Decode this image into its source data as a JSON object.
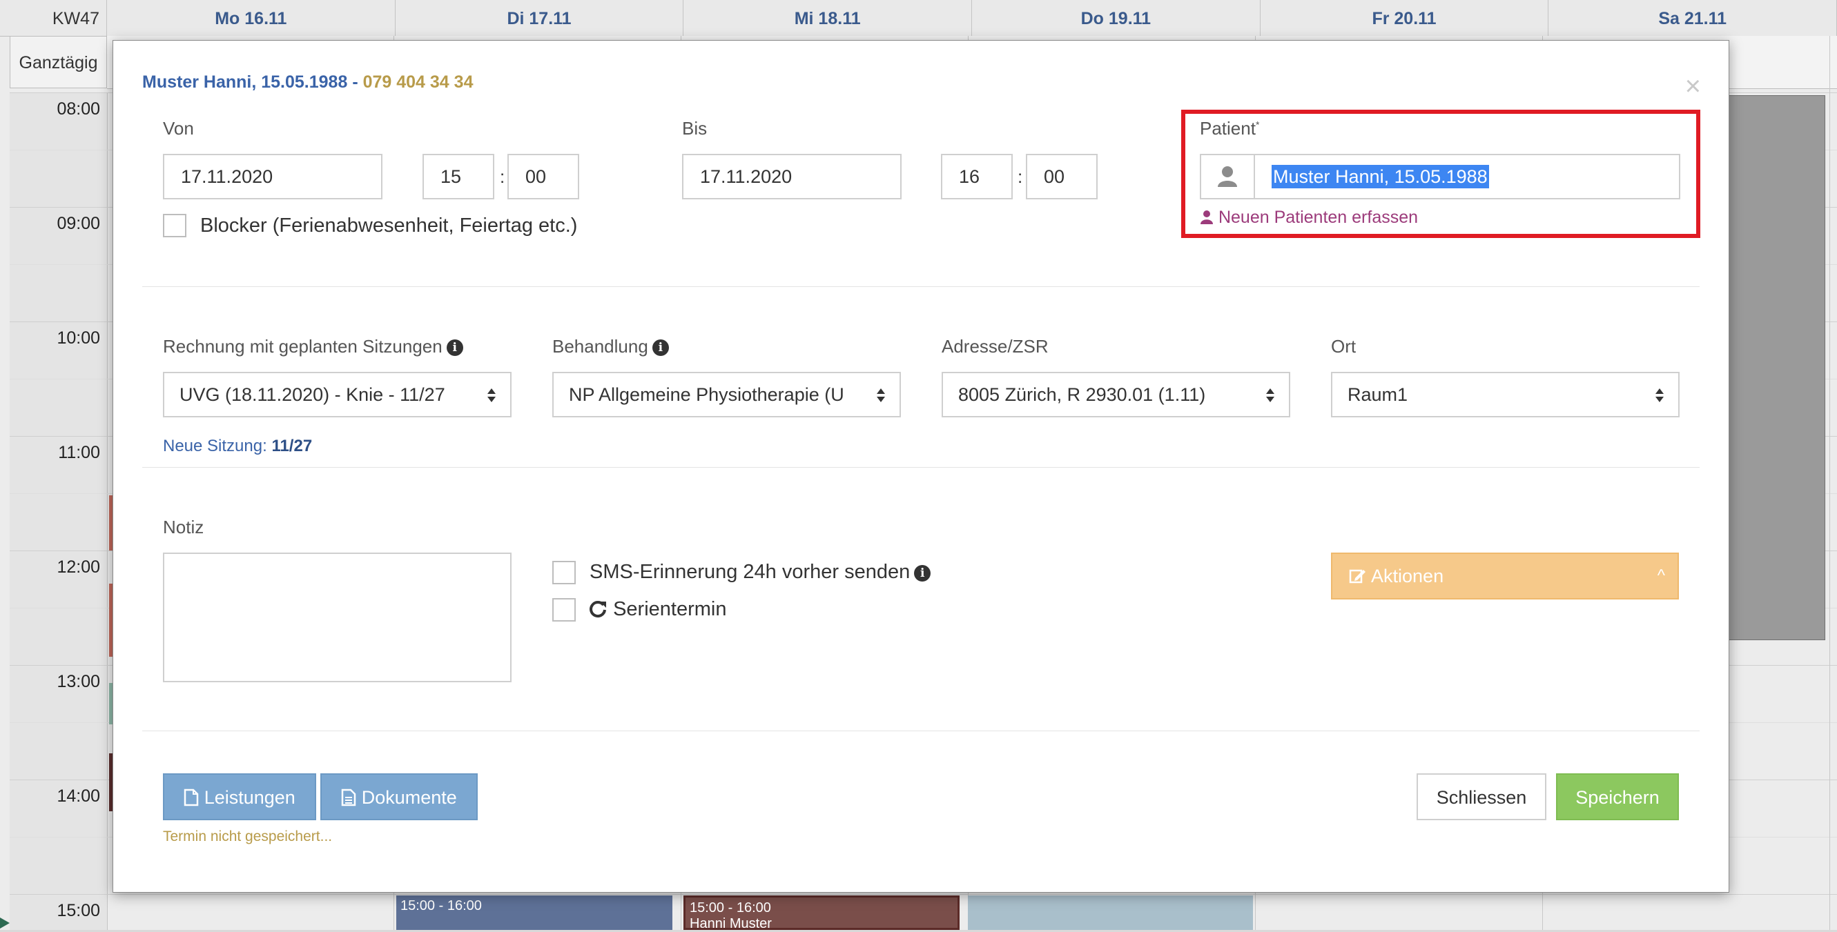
{
  "calendar": {
    "week": "KW47",
    "days": [
      "Mo 16.11",
      "Di 17.11",
      "Mi 18.11",
      "Do 19.11",
      "Fr 20.11",
      "Sa 21.11"
    ],
    "allday_label": "Ganztägig",
    "times": [
      "08:00",
      "09:00",
      "10:00",
      "11:00",
      "12:00",
      "13:00",
      "14:00",
      "15:00"
    ],
    "events": [
      {
        "time": "15:00 - 16:00",
        "title": ""
      },
      {
        "time": "15:00 - 16:00",
        "title": "Hanni Muster"
      }
    ]
  },
  "modal": {
    "title_name": "Muster Hanni, 15.05.1988",
    "title_sep": " - ",
    "title_phone": "079 404 34 34",
    "close_icon": "×",
    "von_label": "Von",
    "von_date": "17.11.2020",
    "von_hour": "15",
    "von_min": "00",
    "bis_label": "Bis",
    "bis_date": "17.11.2020",
    "bis_hour": "16",
    "bis_min": "00",
    "time_sep": ":",
    "blocker_label": "Blocker (Ferienabwesenheit, Feiertag etc.)",
    "patient_label": "Patient",
    "patient_required": "*",
    "patient_value": "Muster Hanni, 15.05.1988",
    "new_patient_label": "Neuen Patienten erfassen",
    "rechnung_label": "Rechnung mit geplanten Sitzungen",
    "rechnung_value": "UVG (18.11.2020) - Knie - 11/27",
    "behandlung_label": "Behandlung",
    "behandlung_value": "NP Allgemeine Physiotherapie (U",
    "adresse_label": "Adresse/ZSR",
    "adresse_value": "8005 Zürich, R 2930.01 (1.11)",
    "ort_label": "Ort",
    "ort_value": "Raum1",
    "session_label": "Neue Sitzung:",
    "session_value": "11/27",
    "notiz_label": "Notiz",
    "sms_label": "SMS-Erinnerung 24h vorher senden",
    "serie_label": "Serientermin",
    "aktionen_label": "Aktionen",
    "leistungen_label": "Leistungen",
    "dokumente_label": "Dokumente",
    "schliessen_label": "Schliessen",
    "speichern_label": "Speichern",
    "unsaved_text": "Termin nicht gespeichert...",
    "info_glyph": "i"
  },
  "colors": {
    "highlight_border": "#e01b24",
    "title_blue": "#3a63a8",
    "phone_gold": "#b89b4a",
    "aktionen_bg": "#f6c98a",
    "save_green": "#8cc85f",
    "doc_blue": "#7ba7d1",
    "new_patient_magenta": "#9c3b7b"
  }
}
